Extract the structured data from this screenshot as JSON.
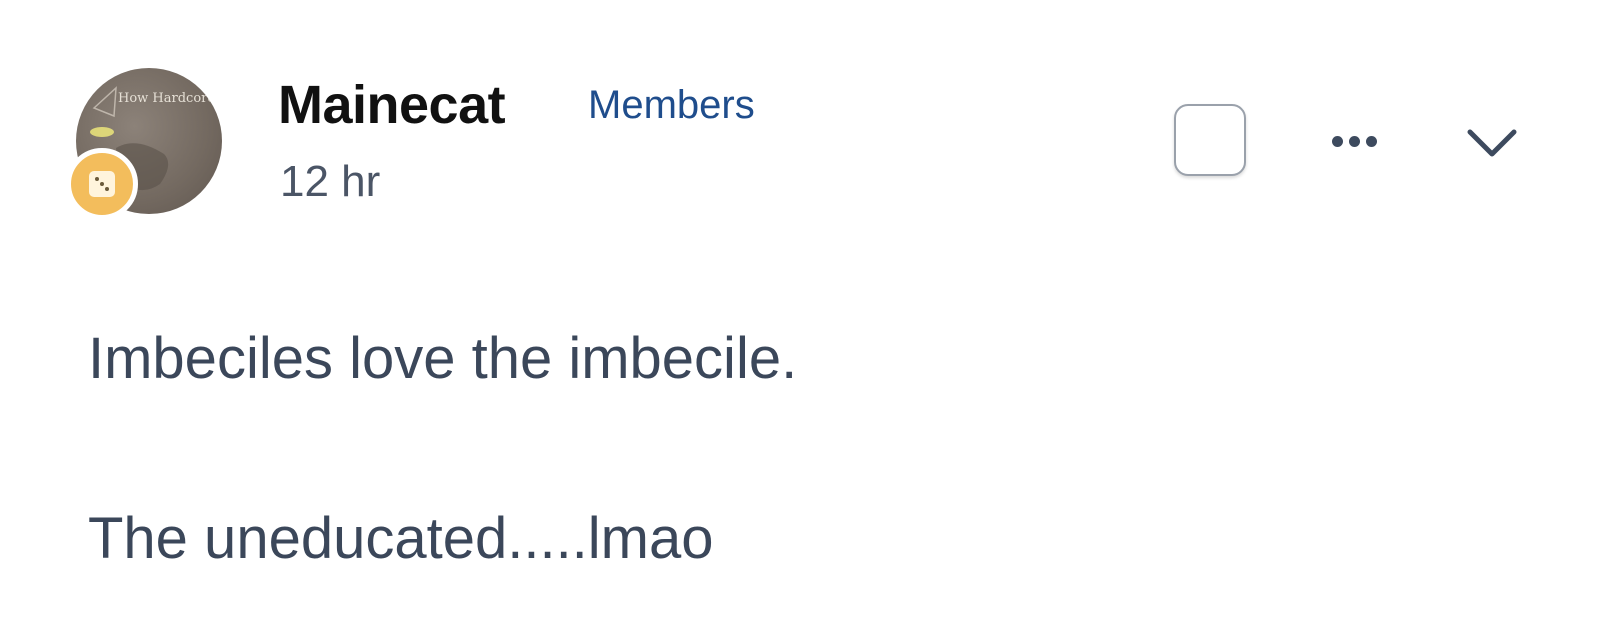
{
  "post": {
    "author": "Mainecat",
    "group": "Members",
    "timestamp": "12 hr",
    "avatar_text": "How Hardcore Are YOU?",
    "body": [
      "Imbeciles love the imbecile.",
      "The uneducated.....lmao"
    ]
  },
  "icons": {
    "badge": "dice-icon",
    "more": "more-dots-icon",
    "expand": "chevron-down-icon",
    "select": "checkbox-icon"
  },
  "colors": {
    "author": "#111111",
    "group_link": "#1f4d8c",
    "meta_text": "#4b5566",
    "body_text": "#3b475a",
    "badge_bg": "#f3bd5c",
    "icon": "#3d4a5e"
  }
}
